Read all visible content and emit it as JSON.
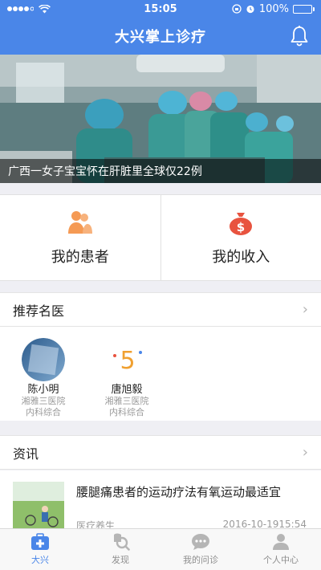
{
  "status_bar": {
    "time": "15:05",
    "battery": "100%",
    "signal_icon": "signal-dots-icon",
    "wifi_icon": "wifi-icon"
  },
  "header": {
    "title": "大兴掌上诊疗",
    "notification_icon": "bell-icon"
  },
  "banner": {
    "caption": "广西一女子宝宝怀在肝脏里全球仅22例"
  },
  "quick_actions": [
    {
      "label": "我的患者",
      "icon": "patient-icon",
      "color": "#f59a54"
    },
    {
      "label": "我的收入",
      "icon": "money-bag-icon",
      "color": "#e8533f"
    }
  ],
  "recommended_doctors": {
    "title": "推荐名医",
    "items": [
      {
        "name": "陈小明",
        "hospital": "湘雅三医院",
        "department": "内科综合"
      },
      {
        "name": "唐旭毅",
        "hospital": "湘雅三医院",
        "department": "内科综合"
      }
    ]
  },
  "news": {
    "title": "资讯",
    "items": [
      {
        "title": "腰腿痛患者的运动疗法有氧运动最适宜",
        "category": "医疗养生",
        "date": "2016-10-1915:54"
      }
    ]
  },
  "tabbar": [
    {
      "label": "大兴",
      "icon": "medical-kit-icon",
      "active": true
    },
    {
      "label": "发现",
      "icon": "discover-search-icon",
      "active": false
    },
    {
      "label": "我的问诊",
      "icon": "chat-bubble-icon",
      "active": false
    },
    {
      "label": "个人中心",
      "icon": "person-icon",
      "active": false
    }
  ],
  "colors": {
    "brand_blue": "#4a86e8",
    "patient_orange": "#f59a54",
    "income_red": "#e8533f",
    "background": "#efeff4"
  }
}
